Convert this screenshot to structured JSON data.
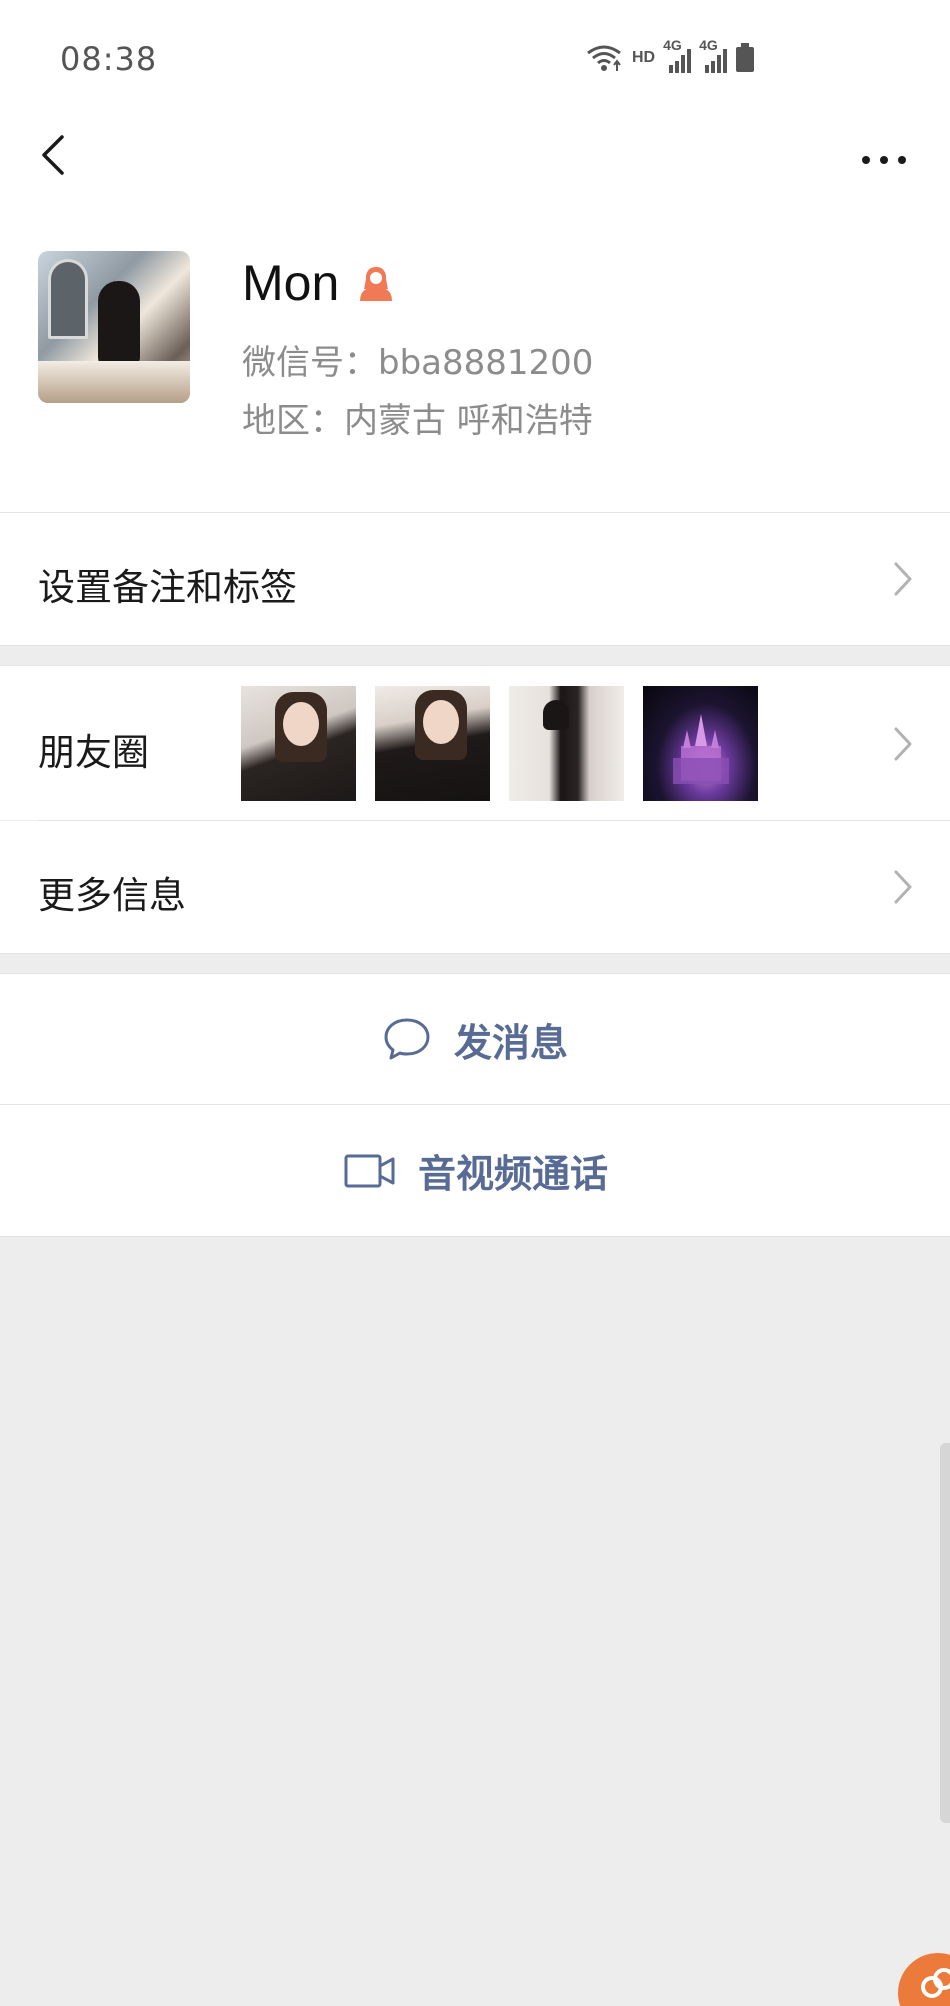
{
  "status_bar": {
    "time": "08:38",
    "hd": "HD",
    "network_1": "4G",
    "network_2": "4G"
  },
  "nav": {
    "back_icon": "chevron-left-icon",
    "more_icon": "more-horizontal-icon"
  },
  "profile": {
    "name": "Mon",
    "gender_icon": "female-icon",
    "gender_color": "#f07a56",
    "wechat_id": "微信号：bba8881200",
    "region": "地区：内蒙古  呼和浩特"
  },
  "rows": {
    "remark_label": "设置备注和标签",
    "moments_label": "朋友圈",
    "more_info_label": "更多信息"
  },
  "actions": {
    "message_label": "发消息",
    "message_icon": "chat-bubble-icon",
    "call_label": "音视频通话",
    "call_icon": "video-camera-icon",
    "accent_color": "#576b95"
  },
  "colors": {
    "background": "#ededed",
    "card": "#ffffff",
    "secondary_text": "#8c8c8c"
  }
}
